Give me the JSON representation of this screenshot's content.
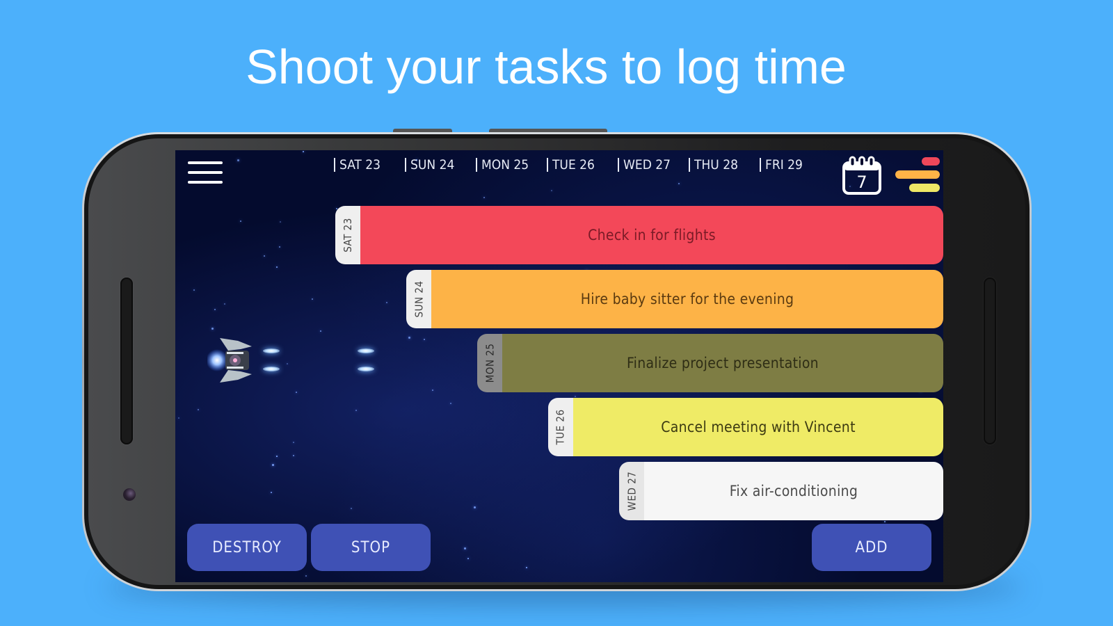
{
  "headline": "Shoot your tasks to log time",
  "app": {
    "menu_icon": "hamburger-menu-icon",
    "calendar_icon": "calendar-icon",
    "calendar_day_count": "7",
    "stack_icon": "color-stack-icon",
    "stack_colors": [
      "#f0475a",
      "#ffb347",
      "#efe866"
    ],
    "days": [
      {
        "label": "SAT 23"
      },
      {
        "label": "SUN 24"
      },
      {
        "label": "MON 25"
      },
      {
        "label": "TUE 26"
      },
      {
        "label": "WED 27"
      },
      {
        "label": "THU 28"
      },
      {
        "label": "FRI 29"
      }
    ],
    "tasks": [
      {
        "day": "SAT 23",
        "title": "Check in for flights",
        "color": "#f34859",
        "text_color": "#7a1a26"
      },
      {
        "day": "SUN 24",
        "title": "Hire baby sitter for the evening",
        "color": "#fdb347",
        "text_color": "#5a3a10"
      },
      {
        "day": "MON 25",
        "title": "Finalize project presentation",
        "color": "#7e7d44",
        "text_color": "#2e2d15"
      },
      {
        "day": "TUE 26",
        "title": "Cancel meeting with Vincent",
        "color": "#efeb66",
        "text_color": "#3c3a12"
      },
      {
        "day": "WED 27",
        "title": "Fix air-conditioning",
        "color": "#f6f6f6",
        "text_color": "#4a4a4a"
      }
    ],
    "buttons": {
      "destroy": "DESTROY",
      "stop": "STOP",
      "add": "ADD"
    },
    "button_color": "#3f51b5"
  }
}
